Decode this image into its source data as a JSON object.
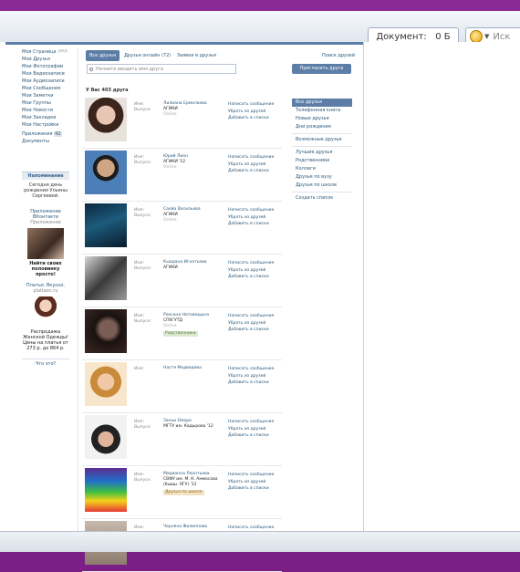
{
  "browser": {
    "doc_label": "Документ:",
    "doc_size": "0 Б",
    "search_placeholder": "Иск"
  },
  "leftnav": {
    "items": [
      "Моя Страница",
      "Мои Друзья",
      "Мои Фотографии",
      "Мои Видеозаписи",
      "Мои Аудиозаписи",
      "Мои Сообщения",
      "Мои Заметки",
      "Мои Группы",
      "Мои Новости",
      "Мои Закладки",
      "Мои Настройки"
    ],
    "edit": "ред.",
    "apps_label": "Приложения",
    "apps_count": "42",
    "docs": "Документы"
  },
  "reminder": {
    "title": "Напоминание",
    "text": "Сегодня день рождения Ульяны Сергеевой."
  },
  "ad1": {
    "title": "Приложение ВКонтакте",
    "sub": "Приложение",
    "caption": "Найти своих половинку просто!"
  },
  "ad2": {
    "title": "Платья. Вкусно.",
    "sub": "platiaon.ru",
    "caption": "Распродажа Женской Одежды! Цены на платья от 273 р. до 864 р."
  },
  "whatsit": "Что это?",
  "tabs": {
    "all": "Все друзья",
    "online": "Друзья онлайн (72)",
    "requests": "Заявки в друзья",
    "search": "Поиск друзей"
  },
  "search_placeholder": "Начните вводить имя друга",
  "invite_button": "Пригласить друга",
  "friend_count": "У Вас 403 друга",
  "label_name": "Имя:",
  "label_grad": "Выпуск:",
  "actions": [
    "Написать сообщение",
    "Убрать из друзей",
    "Добавить в списки"
  ],
  "friends": [
    {
      "name": "Лилиана Ермолаева",
      "uni": "АГИКИ",
      "status": "Online",
      "badge": ""
    },
    {
      "name": "Юрий Лион",
      "uni": "АГИКИ '12",
      "status": "Online",
      "badge": ""
    },
    {
      "name": "Саяйа Васильева",
      "uni": "АГИКИ",
      "status": "Online",
      "badge": ""
    },
    {
      "name": "Кьюдана Игнатьева",
      "uni": "АГИКИ",
      "status": "",
      "badge": ""
    },
    {
      "name": "Роксана Нотовицына",
      "uni": "СПбГУТД",
      "status": "Online",
      "badge": "Родственники"
    },
    {
      "name": "Настя Медведева",
      "uni": "",
      "status": "",
      "badge": ""
    },
    {
      "name": "Зальи Оморе",
      "uni": "МГТУ им. Кадырова '12",
      "status": "",
      "badge": ""
    },
    {
      "name": "Марианна Леонтьева",
      "uni": "СВФУ им. М. К. Аммосова (бывш. ЯГУ) '12",
      "status": "",
      "badge2": "Друзья по школе"
    },
    {
      "name": "Черняна Филипповa",
      "uni": "",
      "status": "",
      "badge": ""
    }
  ],
  "filters": [
    "Все друзья",
    "Телефонная книга",
    "Новые друзья",
    "Дни рождения",
    "Возможные друзья",
    "Лучшие друзья",
    "Родственники",
    "Коллеги",
    "Друзья по вузу",
    "Друзья по школе",
    "Создать список"
  ]
}
